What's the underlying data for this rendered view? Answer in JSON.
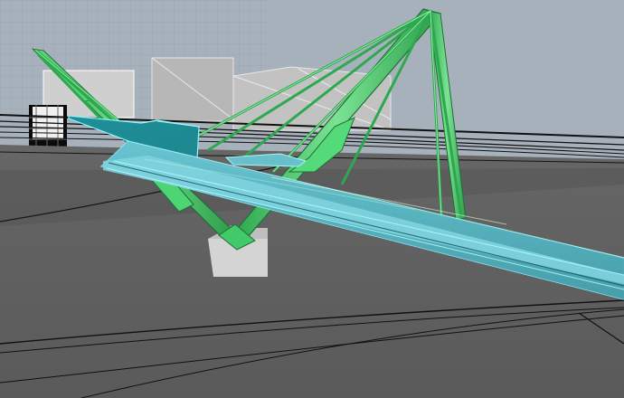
{
  "viewport": {
    "kind": "3d-perspective-viewport",
    "shading": "shaded-with-wireframe",
    "colors": {
      "sky": "#a7b1bb",
      "ground": "#5e5e5e",
      "ground_dark": "#525252",
      "wire": "#111111",
      "deck_top": "#1f7f86",
      "deck_side": "#61b9c6",
      "deck_edge": "#8ff2ff",
      "truss": "#3fbf62",
      "truss_light": "#8bf0a3",
      "building": "#c9c9c9",
      "building_shadow": "#a9a9a9",
      "footing": "#d6d6d6"
    }
  },
  "scene": {
    "objects": [
      {
        "name": "ground-plane",
        "icon": "grid-plane"
      },
      {
        "name": "bridge-deck",
        "icon": "deck-mesh"
      },
      {
        "name": "cable-pylon",
        "icon": "pylon-mesh"
      },
      {
        "name": "stay-cables",
        "icon": "cable-mesh"
      },
      {
        "name": "concrete-footing",
        "icon": "cube-mesh"
      },
      {
        "name": "background-buildings",
        "icon": "building-mesh"
      },
      {
        "name": "lattice-tower",
        "icon": "tower-mesh"
      }
    ]
  }
}
